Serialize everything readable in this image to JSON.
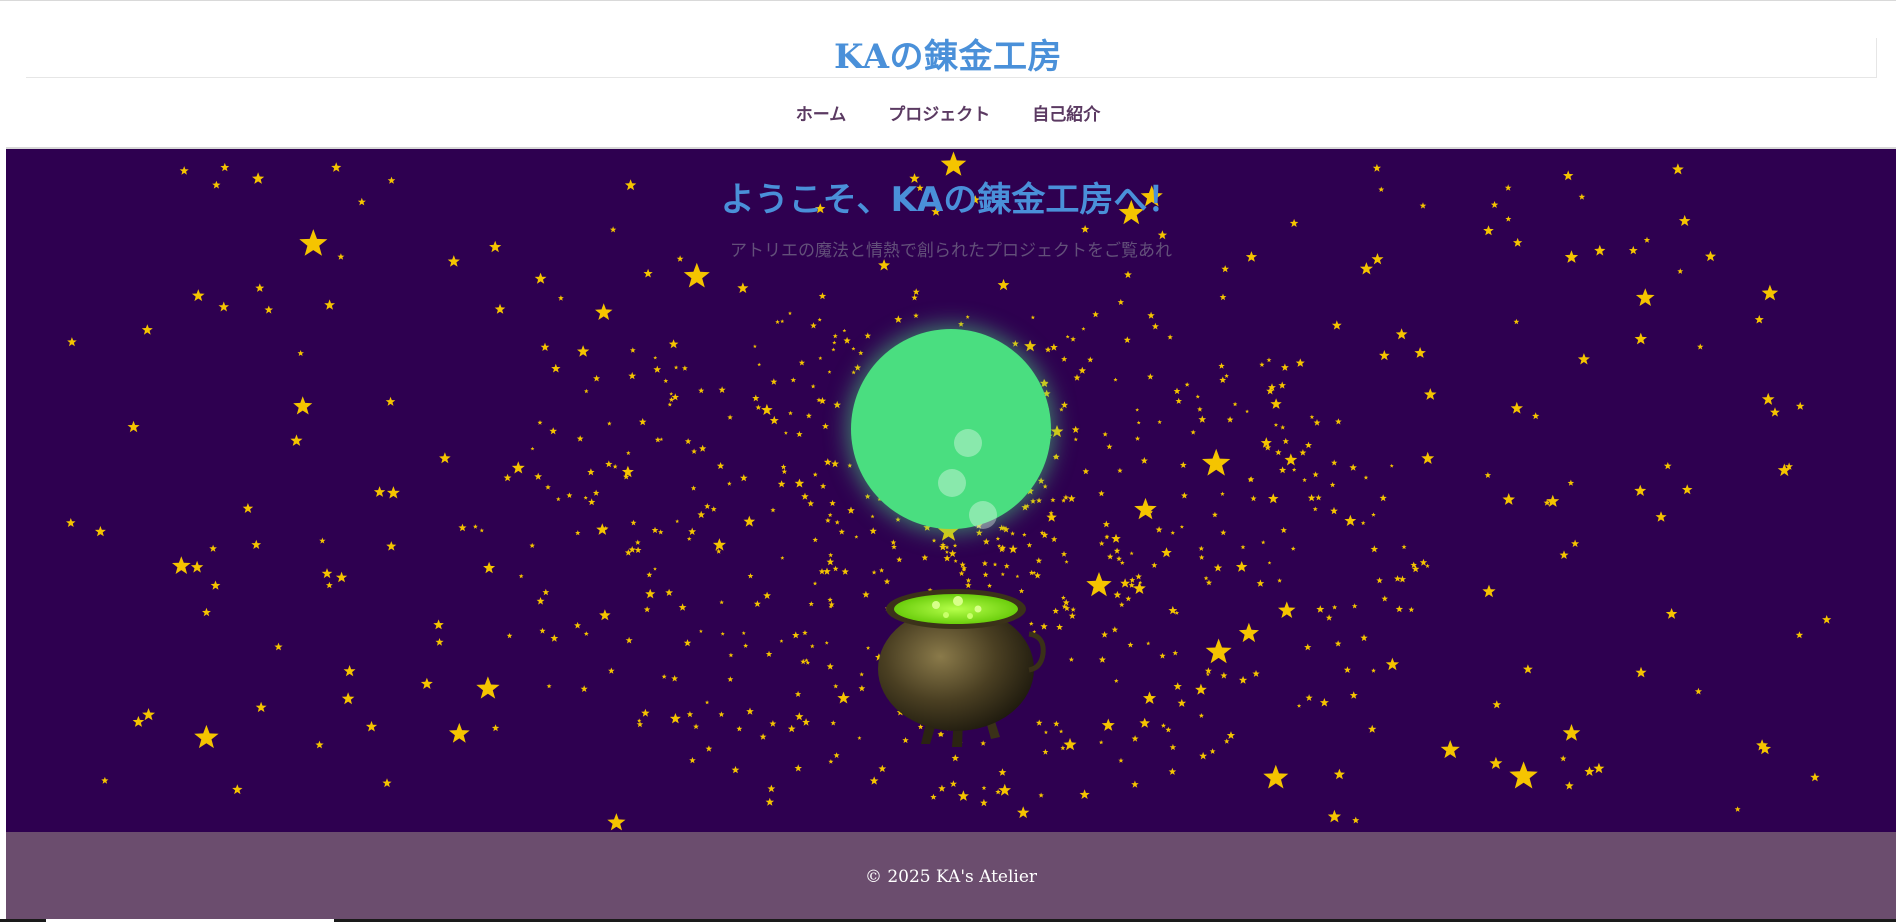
{
  "site": {
    "title": "KAの錬金工房"
  },
  "nav": {
    "items": [
      {
        "label": "ホーム"
      },
      {
        "label": "プロジェクト"
      },
      {
        "label": "自己紹介"
      }
    ]
  },
  "hero": {
    "title": "ようこそ、KAの錬金工房へ！",
    "subtitle": "アトリエの魔法と情熱で創られたプロジェクトをご覧あれ",
    "background_color": "#2e0050",
    "star_color": "#f5c400",
    "orb_color": "#4ade80",
    "cauldron_brew_color": "#7cfc00"
  },
  "footer": {
    "copyright": "© 2025 KA's Atelier",
    "background_color": "#6b4d6e"
  },
  "colors": {
    "accent": "#4a90d9",
    "nav_text": "#5b3a62"
  }
}
